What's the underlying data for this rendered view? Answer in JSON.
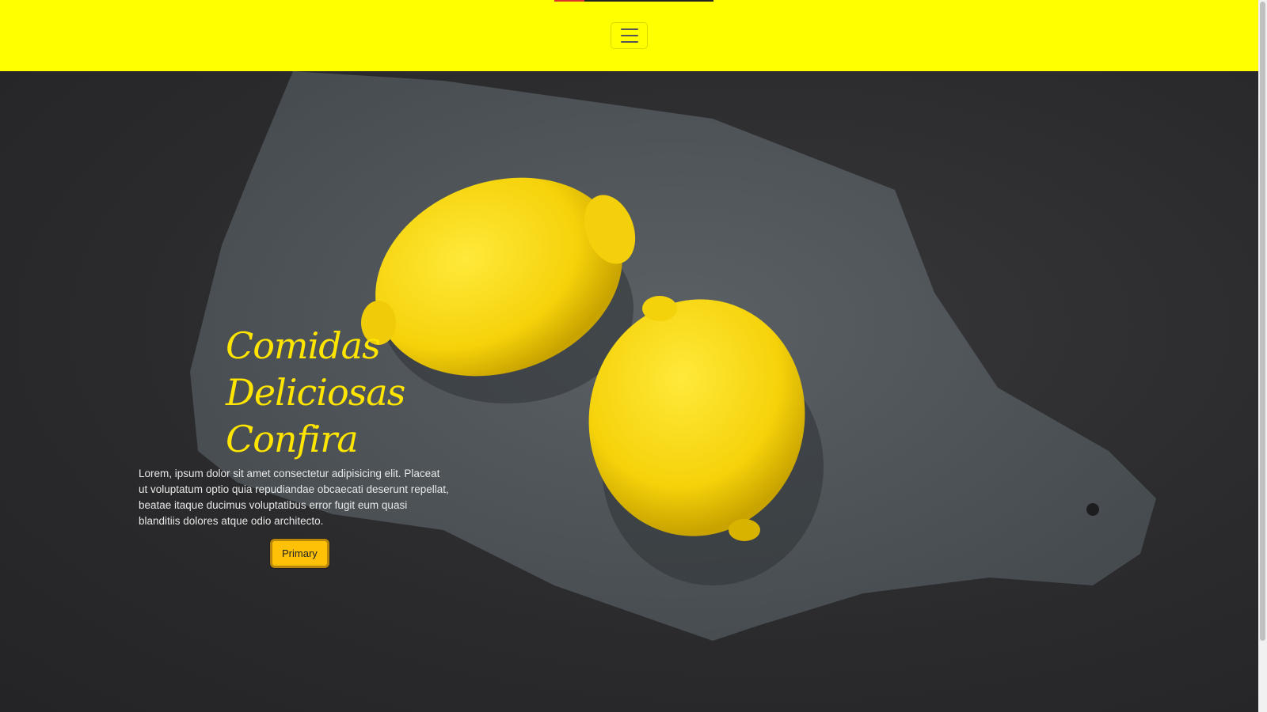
{
  "navbar": {
    "toggler_icon": "hamburger-menu-icon",
    "background": "#ffff00"
  },
  "hero": {
    "title_lines": [
      "Comidas",
      "Deliciosas",
      "Confira"
    ],
    "text": "Lorem, ipsum dolor sit amet consectetur adipisicing elit. Placeat ut voluptatum optio quia repudiandae obcaecati deserunt repellat, beatae itaque ducimus voluptatibus error fugit eum quasi blanditiis dolores atque odio architecto.",
    "button_label": "Primary",
    "title_color": "#ffe500",
    "button_color": "#ffc107"
  }
}
